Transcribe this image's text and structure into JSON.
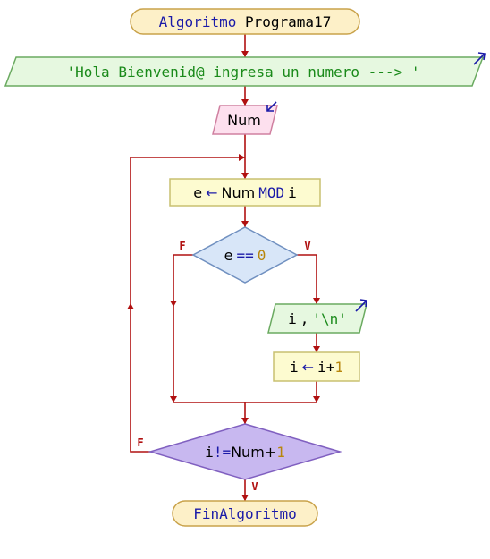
{
  "colors": {
    "flow": "#b01010",
    "keyword": "#1a1aa8",
    "string": "#1a8a1a",
    "number": "#b8860b",
    "operator": "#1a1aa8",
    "terminal_fill": "#fdf0c8",
    "terminal_stroke": "#c9a24a",
    "process_fill": "#fdfbd0",
    "process_stroke": "#c8c070",
    "output_fill": "#e6f8e0",
    "output_stroke": "#6aaa60",
    "input_fill": "#fde0ee",
    "input_stroke": "#d080a0",
    "decision_fill": "#d8e6f8",
    "decision_stroke": "#7090c0",
    "loop_fill": "#c8b8f0",
    "loop_stroke": "#8060c0"
  },
  "start": {
    "keyword": "Algoritmo",
    "name": "Programa17"
  },
  "write_greeting": {
    "text": "'Hola Bienvenid@ ingresa un numero  ---> '"
  },
  "read_num": {
    "text": "Num"
  },
  "assign_e": {
    "target": "e",
    "arrow": "←",
    "operand": "Num",
    "op": "MOD",
    "var": "i"
  },
  "decision_e": {
    "left": "e",
    "op": "==",
    "right": "0",
    "true_label": "V",
    "false_label": "F"
  },
  "write_i": {
    "var": "i",
    "comma": ",",
    "string": "'\\n'"
  },
  "assign_i": {
    "target": "i",
    "arrow": "←",
    "expr": "i+",
    "num": "1"
  },
  "loop_condition": {
    "left": "i",
    "op": "!=",
    "mid": "Num+",
    "num": "1",
    "true_label": "V",
    "false_label": "F"
  },
  "end": {
    "keyword": "FinAlgoritmo"
  }
}
